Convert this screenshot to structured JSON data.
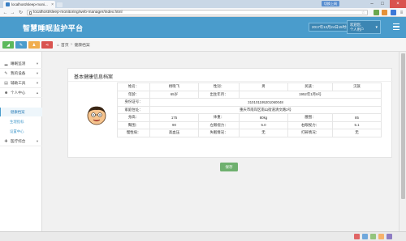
{
  "browser": {
    "tab_title": "localhost/sleep-moni...",
    "url": "localhost/sleep-monitoring/web-manager/index.html",
    "badge": "切换上网"
  },
  "header": {
    "brand": "智慧睡眠监护平台",
    "datetime": "2017年12月24日15时14分06秒",
    "user_line1": "欢迎您,",
    "user_line2": "个人用户"
  },
  "toolbar": {
    "buttons": [
      {
        "icon": "chart-icon",
        "color": "#5cb85c"
      },
      {
        "icon": "pencil-icon",
        "color": "#4a9ccc"
      },
      {
        "icon": "users-icon",
        "color": "#f0ad4e"
      },
      {
        "icon": "share-icon",
        "color": "#d9534f"
      }
    ]
  },
  "breadcrumb": {
    "home": "首页",
    "current": "健康档案"
  },
  "sidebar": {
    "items": [
      {
        "label": "睡眠监测",
        "icon": "signal-icon"
      },
      {
        "label": "我的设备",
        "icon": "pencil-icon"
      },
      {
        "label": "辅助工具",
        "icon": "table-icon"
      },
      {
        "label": "个人中心",
        "icon": "user-icon"
      },
      {
        "label": "医疗综合",
        "icon": "medical-icon"
      }
    ],
    "sub_items": [
      {
        "label": "健康档案",
        "active": true
      },
      {
        "label": "生理指标",
        "active": false
      },
      {
        "label": "设置中心",
        "active": false
      }
    ]
  },
  "panel": {
    "title": "基本健康信息档案",
    "rows": [
      [
        [
          "姓名：",
          "lbl"
        ],
        [
          "杨晓飞",
          "val"
        ],
        [
          "性别：",
          "lbl"
        ],
        [
          "男",
          "val"
        ],
        [
          "民族：",
          "lbl"
        ],
        [
          "汉族",
          "val"
        ]
      ],
      [
        [
          "年龄：",
          "lbl"
        ],
        [
          "65岁",
          "val"
        ],
        [
          "出生年月：",
          "lbl"
        ],
        [
          "1952年1月6号",
          "val",
          3
        ]
      ],
      [
        [
          "身份证号：",
          "lbl"
        ],
        [
          "310101195201060048",
          "val",
          5
        ]
      ],
      [
        [
          "家庭住址：",
          "lbl"
        ],
        [
          "重庆市南岸区南山街道清文路2号",
          "val",
          5
        ]
      ],
      [
        [
          "身高：",
          "lbl"
        ],
        [
          "175",
          "val"
        ],
        [
          "体重：",
          "lbl"
        ],
        [
          "80kg",
          "val"
        ],
        [
          "腰围：",
          "lbl"
        ],
        [
          "85",
          "val"
        ]
      ],
      [
        [
          "臀围：",
          "lbl"
        ],
        [
          "90",
          "val"
        ],
        [
          "左眼视力：",
          "lbl"
        ],
        [
          "5.0",
          "val"
        ],
        [
          "右眼视力：",
          "lbl"
        ],
        [
          "5.1",
          "val"
        ]
      ],
      [
        [
          "慢性病：",
          "lbl"
        ],
        [
          "高血压",
          "val"
        ],
        [
          "失眠情况：",
          "lbl"
        ],
        [
          "无",
          "val"
        ],
        [
          "打鼾情况：",
          "lbl"
        ],
        [
          "无",
          "val"
        ]
      ]
    ],
    "save_label": "保存"
  }
}
